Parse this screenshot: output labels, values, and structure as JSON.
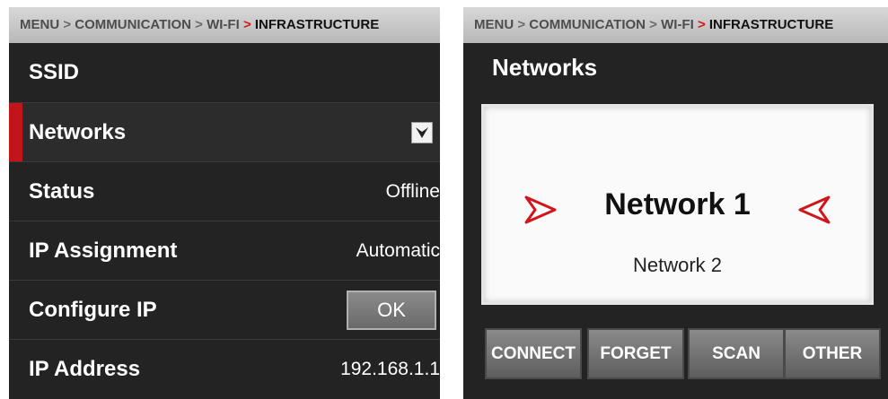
{
  "left_panel": {
    "breadcrumb": {
      "items": [
        "MENU",
        "COMMUNICATION",
        "WI-FI"
      ],
      "current": "INFRASTRUCTURE",
      "separator": ">"
    },
    "rows": {
      "ssid": {
        "label": "SSID"
      },
      "networks": {
        "label": "Networks"
      },
      "status": {
        "label": "Status",
        "value": "Offline"
      },
      "ip_assignment": {
        "label": "IP Assignment",
        "value": "Automatic"
      },
      "configure_ip": {
        "label": "Configure IP",
        "button": "OK"
      },
      "ip_address": {
        "label": "IP Address",
        "value": "192.168.1.1"
      }
    },
    "icons": {
      "dropdown": "chevron-down-icon"
    }
  },
  "right_panel": {
    "breadcrumb": {
      "items": [
        "MENU",
        "COMMUNICATION",
        "WI-FI"
      ],
      "current": "INFRASTRUCTURE",
      "separator": ">"
    },
    "title": "Networks",
    "networks": [
      "Network 1",
      "Network 2"
    ],
    "selected_network": "Network 1",
    "next_network": "Network 2",
    "buttons": {
      "connect": "CONNECT",
      "forget": "FORGET",
      "scan": "SCAN",
      "other": "OTHER"
    },
    "icons": {
      "left": "arrow-right-icon",
      "right": "arrow-left-icon"
    }
  },
  "colors": {
    "accent": "#c4141b",
    "panel_bg": "#232323",
    "breadcrumb_bg": "#c8c8c8"
  }
}
